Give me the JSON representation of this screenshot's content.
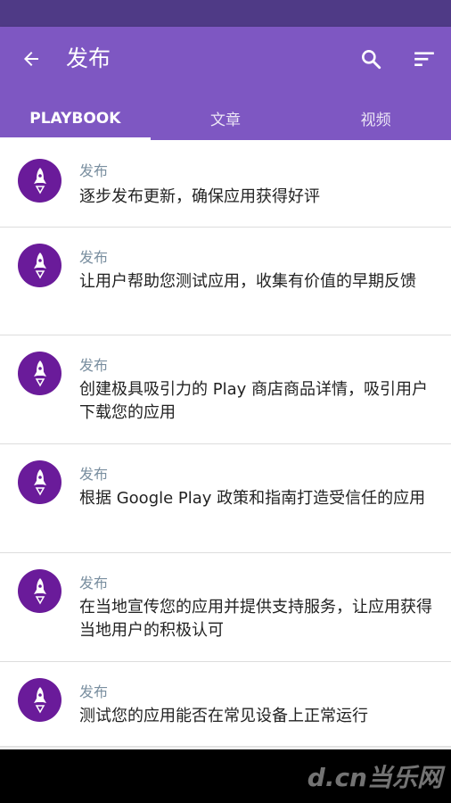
{
  "app_bar": {
    "title": "发布",
    "colors": {
      "primary": "#7e57c2",
      "status_bar": "#4f3a86"
    }
  },
  "tabs": [
    {
      "label": "PLAYBOOK",
      "active": true
    },
    {
      "label": "文章",
      "active": false
    },
    {
      "label": "视频",
      "active": false
    }
  ],
  "items": [
    {
      "tag": "发布",
      "text": "逐步发布更新，确保应用获得好评",
      "icon": "rocket-icon"
    },
    {
      "tag": "发布",
      "text": "让用户帮助您测试应用，收集有价值的早期反馈",
      "icon": "rocket-icon"
    },
    {
      "tag": "发布",
      "text": "创建极具吸引力的 Play 商店商品详情，吸引用户下载您的应用",
      "icon": "rocket-icon"
    },
    {
      "tag": "发布",
      "text": "根据 Google Play 政策和指南打造受信任的应用",
      "icon": "rocket-icon"
    },
    {
      "tag": "发布",
      "text": "在当地宣传您的应用并提供支持服务，让应用获得当地用户的积极认可",
      "icon": "rocket-icon"
    },
    {
      "tag": "发布",
      "text": "测试您的应用能否在常见设备上正常运行",
      "icon": "rocket-icon"
    }
  ],
  "watermark": {
    "text": "d.cn当乐网"
  }
}
